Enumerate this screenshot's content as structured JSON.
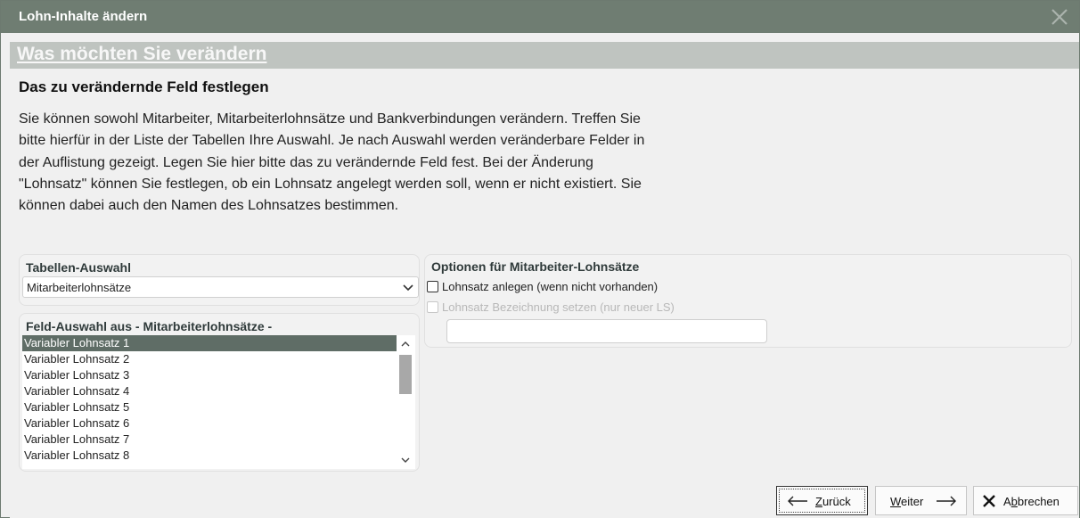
{
  "window": {
    "title": "Lohn-Inhalte ändern",
    "close_icon": "close-icon",
    "accent": "#6f7d72"
  },
  "banner": {
    "title": "Was möchten Sie verändern"
  },
  "heading": "Das zu verändernde Feld festlegen",
  "description": "Sie können sowohl Mitarbeiter, Mitarbeiterlohnsätze und Bankverbindungen verändern. Treffen Sie bitte hierfür in der Liste der Tabellen Ihre Auswahl. Je nach Auswahl werden veränderbare Felder in der Auflistung gezeigt. Legen Sie hier bitte das zu verändernde Feld fest. Bei der Änderung \"Lohnsatz\" können Sie festlegen, ob ein Lohnsatz angelegt werden soll, wenn er nicht existiert. Sie können dabei auch den Namen des Lohnsatzes bestimmen.",
  "table_select": {
    "group_title": "Tabellen-Auswahl",
    "selected": "Mitarbeiterlohnsätze"
  },
  "field_list": {
    "group_title": "Feld-Auswahl aus - Mitarbeiterlohnsätze -",
    "items": [
      "Variabler Lohnsatz 1",
      "Variabler Lohnsatz 2",
      "Variabler Lohnsatz 3",
      "Variabler Lohnsatz 4",
      "Variabler Lohnsatz 5",
      "Variabler Lohnsatz 6",
      "Variabler Lohnsatz 7",
      "Variabler Lohnsatz 8"
    ],
    "selected_index": 0
  },
  "options": {
    "group_title": "Optionen für Mitarbeiter-Lohnsätze",
    "create_rate_label": "Lohnsatz anlegen (wenn nicht vorhanden)",
    "create_rate_checked": false,
    "set_name_label": "Lohnsatz Bezeichnung setzen (nur neuer LS)",
    "set_name_checked": false,
    "name_value": ""
  },
  "buttons": {
    "back": {
      "prefix": "",
      "underlined": "Z",
      "rest": "urück"
    },
    "next": {
      "underlined": "W",
      "rest": "eiter"
    },
    "cancel": {
      "prefix": "A",
      "underlined": "b",
      "rest": "brechen"
    }
  }
}
